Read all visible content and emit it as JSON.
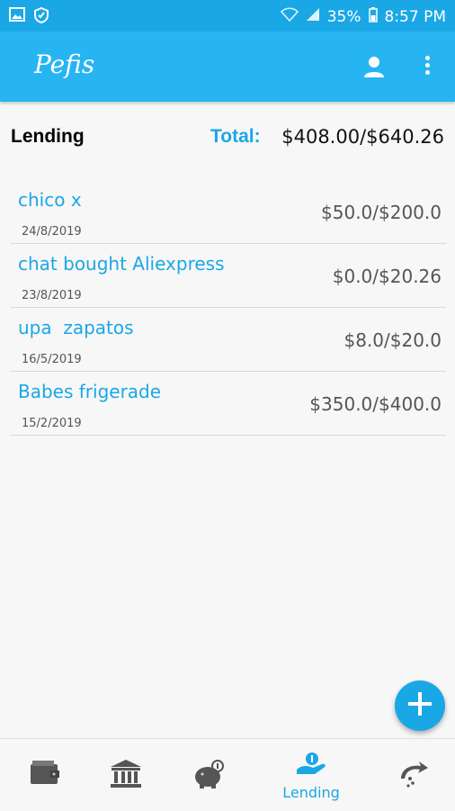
{
  "status_bar": {
    "battery": "35%",
    "time": "8:57 PM",
    "icons": [
      "image-icon",
      "shield-icon",
      "wifi-icon",
      "signal-icon",
      "battery-icon"
    ]
  },
  "app_bar": {
    "title": "Pefis",
    "icons": [
      "profile-icon",
      "more-vert-icon"
    ]
  },
  "summary": {
    "section_label": "Lending",
    "total_label": "Total:",
    "total_value": "$408.00/$640.26"
  },
  "items": [
    {
      "name": "chico x",
      "date": "24/8/2019",
      "amount": "$50.0/$200.0"
    },
    {
      "name": "chat bought Aliexpress",
      "date": "23/8/2019",
      "amount": "$0.0/$20.26"
    },
    {
      "name": "upa  zapatos",
      "date": "16/5/2019",
      "amount": "$8.0/$20.0"
    },
    {
      "name": "Babes frigerade",
      "date": "15/2/2019",
      "amount": "$350.0/$400.0"
    }
  ],
  "fab": {
    "icon": "add-icon"
  },
  "bottom_nav": {
    "items": [
      {
        "icon": "wallet-icon",
        "label": ""
      },
      {
        "icon": "bank-icon",
        "label": ""
      },
      {
        "icon": "piggy-bank-icon",
        "label": ""
      },
      {
        "icon": "lending-hand-icon",
        "label": "Lending"
      },
      {
        "icon": "money-transfer-icon",
        "label": ""
      }
    ],
    "active": "Lending"
  },
  "colors": {
    "primary": "#27b4f3",
    "status_bar": "#1aa7e6",
    "accent_text": "#1aa7e6",
    "amount_text": "#555555",
    "icon_gray": "#555555"
  }
}
